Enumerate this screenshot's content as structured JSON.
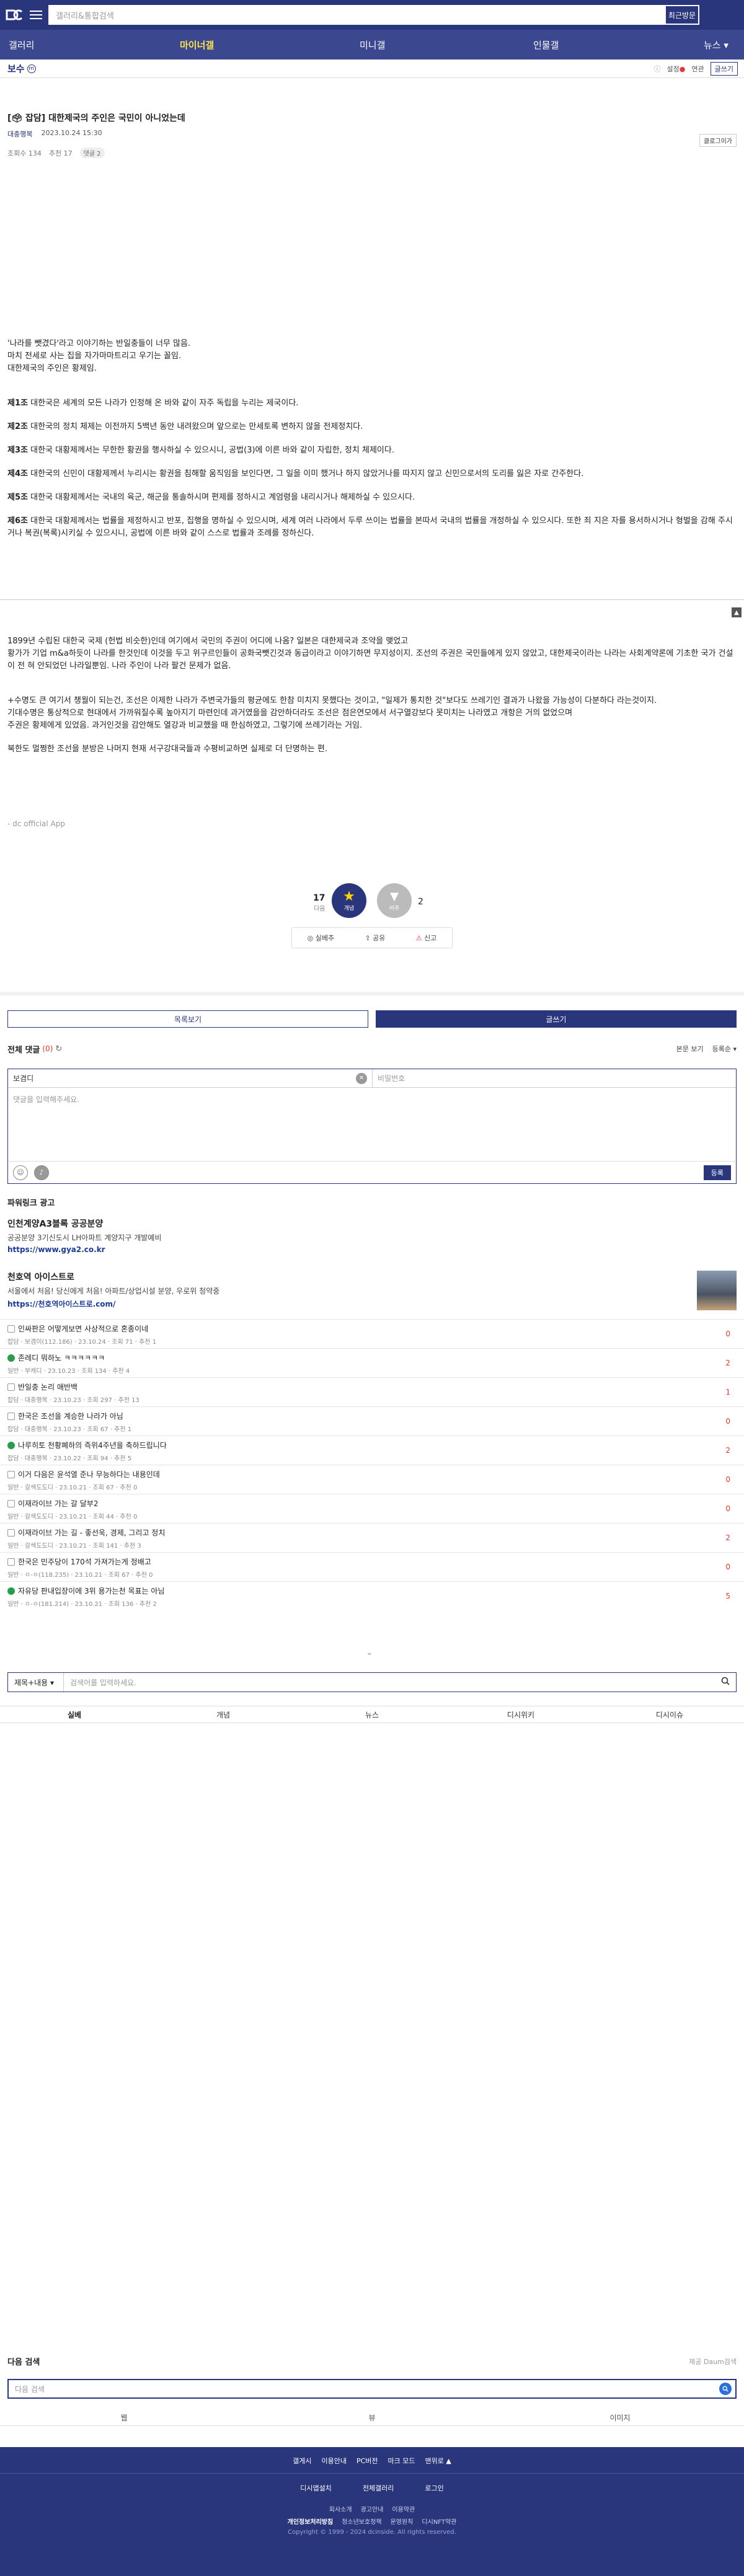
{
  "header": {
    "search_placeholder": "갤러리&통합검색",
    "recent_label": "최근방문"
  },
  "nav": {
    "items": [
      "갤러리",
      "마이너갤",
      "미니갤",
      "인물갤",
      "뉴스 ▾"
    ],
    "active_index": 1
  },
  "gallery": {
    "name": "보수",
    "badge": "m",
    "settings": "설정",
    "setting_dot": "●",
    "mode": "연관",
    "write": "글쓰기"
  },
  "post": {
    "title": "[🗳 잡담] 대한제국의 주인은 국민이 아니었는데",
    "author": "대충행복",
    "date": "2023.10.24 15:30",
    "views": "조회수 134",
    "likes": "추천 17",
    "comments_badge": "댓글 2",
    "mobile_btn": "클로그이가",
    "body": [
      "'나라를 뺏겼다'라고 이야기하는 반일충들이 너무 많음.",
      "마치 전세로 사는 집을 자가마마트리고 우기는 꼴임.",
      "대한제국의 주인은 황제임."
    ],
    "articles": [
      {
        "n": "제1조",
        "t": "대한국은 세계의 모든 나라가 인정해 온 바와 같이 자주 독립을 누리는 제국이다."
      },
      {
        "n": "제2조",
        "t": "대한국의 정치 체제는 이전까지 5백년 동안 내려왔으며 앞으로는 만세토록 변하지 않을 전제정치다."
      },
      {
        "n": "제3조",
        "t": "대한국 대황제께서는 무한한 황권을 행사하실 수 있으시니, 공법(3)에 이른 바와 같이 자립한, 정치 체제이다."
      },
      {
        "n": "제4조",
        "t": "대한국의 신민이 대황제께서 누리시는 황권을 침해할 움직임을 보인다면, 그 일을 이미 했거나 하지 않았거나를 따지지 않고 신민으로서의 도리를 잃은 자로 간주한다."
      },
      {
        "n": "제5조",
        "t": "대한국 대황제께서는 국내의 육군, 해군을 통솔하시며 편제를 정하시고 계엄령을 내리시거나 해제하실 수 있으시다."
      },
      {
        "n": "제6조",
        "t": "대한국 대황제께서는 법률을 제정하시고 반포, 집행을 명하실 수 있으시며, 세계 여러 나라에서 두루 쓰이는 법률을 본따서 국내의 법률을 개정하실 수 있으시다. 또한 죄 지은 자를 용서하시거나 형벌을 감해 주시거나 복권(복록)시키실 수 있으시니, 공법에 이른 바와 같이 스스로 법률과 조례를 정하신다."
      }
    ],
    "body2": [
      "1899년 수립된 대한국 국제 (헌법 비슷한)인데 여기에서 국민의 주권이 어디에 나옴? 일본은 대한제국과 조약을 맺었고",
      "황가가 기업 m&a하듯이 나라를 한것인데 이것을 두고 위구르인들이 공화국뺏긴것과 동급이라고 이야기하면 무지성이지. 조선의 주권은 국민들에게 있지 않았고, 대한제국이라는 나라는 사회계약론에 기초한 국가 건설이 전 혀 안되었던 나라일뿐임. 나라 주인이 나라 팔건 문제가 없음.",
      "",
      "+수명도 큰 여기서 챙월이 되는건, 조선은 이제한 나라가 주변국가들의 평균에도 한참 미치지 못했다는 것이고, \"일제가 통치한 것\"보다도 쓰레기인 결과가 나왔을 가능성이 다분하다 라는것이지.",
      "기대수명은 통상적으로 현대에서 가까워질수록 높아지기 마련인데 과거였을을 감안하더라도 조선은 점은연모에서 서구열강보다 못미치는 나라였고 개항은 거의 없었으며",
      "주권은 황제에게 있었음. 과거인것을 감안해도 열강과 비교했을 때 한심하였고, 그렇기에 쓰레기라는 거임.",
      "",
      "북한도 멀쩡한 조선을 분방은 나머지 현재 서구강대국들과 수평비교하면 실제로 더 단명하는 편."
    ],
    "signature": "- dc official App"
  },
  "vote": {
    "up_count": "17",
    "up_sub": "다음",
    "up_label": "개념",
    "up_icon": "★",
    "down_icon": "▼",
    "down_label": "비추",
    "down_count": "2"
  },
  "actions": [
    "실베추",
    "공유",
    "신고"
  ],
  "list_buttons": {
    "list": "목록보기",
    "write": "글쓰기"
  },
  "comments": {
    "title": "전체 댓글",
    "count": "(0)",
    "refresh_icon": "↻",
    "sort1": "본문 보기",
    "sort2": "등록순 ▾",
    "nick_value": "보겸디",
    "clear_icon": "✕",
    "pw_placeholder": "비밀번호",
    "text_placeholder": "댓글을 입력해주세요.",
    "emoji_icon": "☺",
    "voice_icon": "♪",
    "submit": "등록"
  },
  "powerlink": {
    "title": "파워링크 광고",
    "ads": [
      {
        "t": "인천계양A3블록 공공분양",
        "s": "공공분양 3기신도시 LH아파트 계양지구 개발예비",
        "l": "https://www.gya2.co.kr"
      },
      {
        "t": "천호역 아이스트로",
        "s": "서울에서 처음! 당신에게 처음! 아파트/상업시설 분양, 우로위 청약중",
        "l": "https://천호역아이스트로.com/"
      }
    ]
  },
  "related": [
    {
      "t": "인싸판은 어떻게보면 사상적으로 혼종이네",
      "m": "잡담 · 보겸이(112.186) · 23.10.24 · 조회 71 · 추천 1",
      "c": "0"
    },
    {
      "t": "존레디 뭐하노 ㅋㅋㅋㅋㅋㅋ",
      "m": "일반 · 부캐디 · 23.10.23 · 조회 134 · 추천 4",
      "c": "2"
    },
    {
      "t": "반일충 논리 애반백",
      "m": "잡담 · 대충행복 · 23.10.23 · 조회 297 · 추천 13",
      "c": "1"
    },
    {
      "t": "한국은 조선을 계승한 나라가 아님",
      "m": "잡담 · 대충행복 · 23.10.23 · 조회 67 · 추천 1",
      "c": "0"
    },
    {
      "t": "나루히토 천황폐하의 즉위4주년을 축하드립니다",
      "m": "잡담 · 대충행복 · 23.10.22 · 조회 94 · 추천 5",
      "c": "2"
    },
    {
      "t": "이거 다음은 윤석열 준나 무능하다는 내용인데",
      "m": "일반 · 갈색도도디 · 23.10.21 · 조회 67 · 추천 0",
      "c": "0"
    },
    {
      "t": "이재라이브 가는 갈 달부2",
      "m": "일반 · 갈색도도디 · 23.10.21 · 조회 44 · 추천 0",
      "c": "0"
    },
    {
      "t": "이재라이브 가는 길 - 좋선욱, 경제, 그리고 정치",
      "m": "일반 · 갈색도도디 · 23.10.21 · 조회 141 · 추천 3",
      "c": "2"
    },
    {
      "t": "한국은 민주당이 170석 가져가는게 정배고",
      "m": "일반 · ㅇ-ㅇ(118.235) · 23.10.21 · 조회 67 · 추천 0",
      "c": "0"
    },
    {
      "t": "자유당 판내입장이에 3위 용가는천 목표는 아님",
      "m": "일반 · ㅇ-ㅇ(181.214) · 23.10.21 · 조회 136 · 추천 2",
      "c": "5"
    }
  ],
  "more_icon": "⌄",
  "search": {
    "select": "제목+내용 ▾",
    "placeholder": "검색어를 입력하세요."
  },
  "tabs": [
    "실베",
    "개념",
    "뉴스",
    "디시위키",
    "디시이슈"
  ],
  "next_search": {
    "title": "다음 검색",
    "powered": "제공 Daum검색",
    "placeholder": "다음 검색",
    "tabs": [
      "웹",
      "뷰",
      "이미지"
    ]
  },
  "footer": {
    "row1": [
      "갤게시",
      "이용안내",
      "PC버전",
      "마크 모드",
      "맨위로 ▲"
    ],
    "row2": [
      "디시앱설치",
      "전체갤러리",
      "로그인"
    ],
    "row3": [
      "회사소개",
      "광고안내",
      "이용약관"
    ],
    "row4": [
      "개인정보처리방침",
      "청소년보호정책",
      "운영원칙",
      "디시NFT약관"
    ],
    "copyright": "Copyright © 1999 - 2024 dcinside. All rights reserved."
  }
}
